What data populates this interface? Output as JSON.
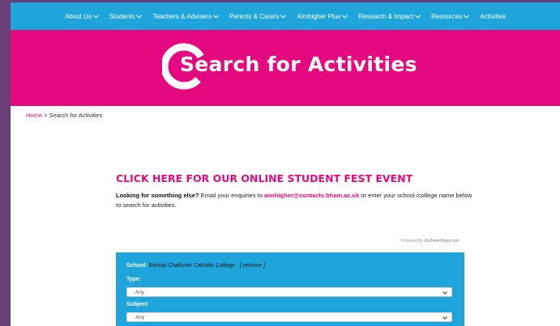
{
  "nav": {
    "items": [
      {
        "label": "About Us",
        "has_dropdown": true
      },
      {
        "label": "Students",
        "has_dropdown": true
      },
      {
        "label": "Teachers & Advisers",
        "has_dropdown": true
      },
      {
        "label": "Parents & Carers",
        "has_dropdown": true
      },
      {
        "label": "Aimhigher Plus",
        "has_dropdown": true
      },
      {
        "label": "Research & Impact",
        "has_dropdown": true
      },
      {
        "label": "Resources",
        "has_dropdown": true
      },
      {
        "label": "Activities",
        "has_dropdown": false
      }
    ]
  },
  "hero": {
    "title": "Search for Activities"
  },
  "breadcrumb": {
    "home": "Home",
    "separator": " > ",
    "current": "Search for Activities"
  },
  "main": {
    "fest_link": "CLICK HERE FOR OUR ONLINE STUDENT FEST EVENT",
    "intro_bold": "Looking for something else?",
    "intro_text1": " Email your enquiries to ",
    "intro_email": "aimhigher@contacts.bham.ac.uk",
    "intro_text2": " or enter your school /college name below to search for activities."
  },
  "powered": {
    "prefix": "Powered By ",
    "link": "UniTasterDays.com"
  },
  "form": {
    "school_label": "School:",
    "school_name": "Bishop Challoner Catholic College",
    "remove_label": "[ remove ]",
    "type_label": "Type:",
    "type_value": "Any",
    "subject_label": "Subject:",
    "subject_value": "Any"
  },
  "colors": {
    "nav_bg": "#1fa5dc",
    "hero_bg": "#e5097f",
    "accent": "#e5097f",
    "outer_bg": "#6a3f78"
  }
}
